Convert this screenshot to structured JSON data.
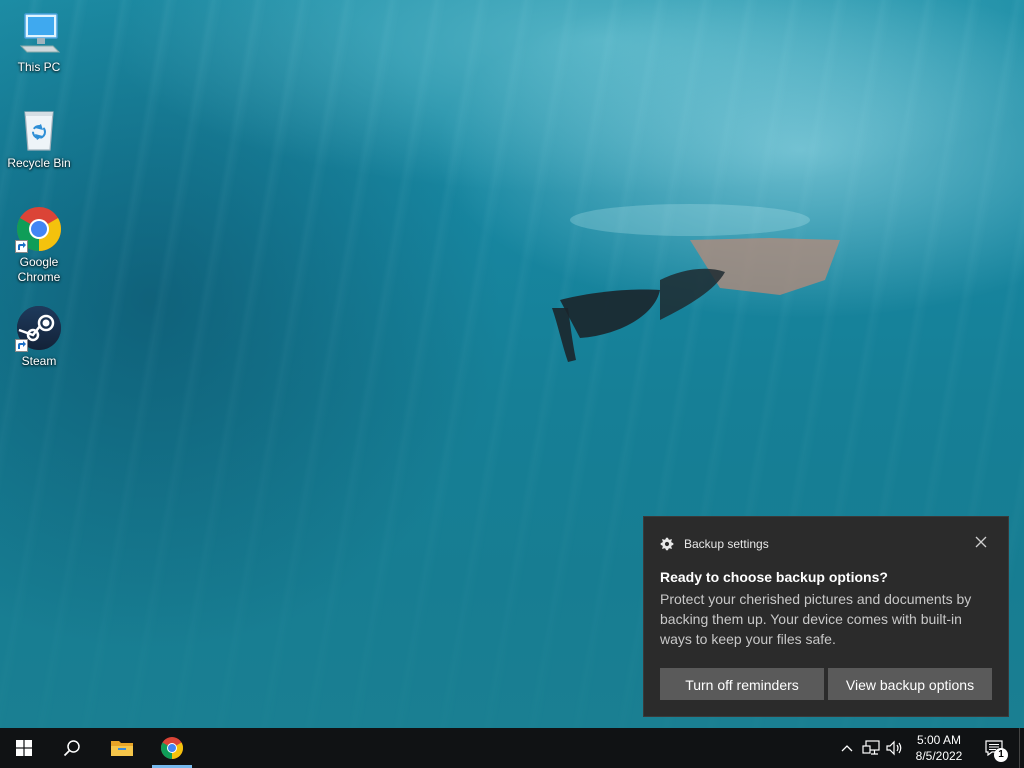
{
  "desktop": {
    "icons": [
      {
        "label": "This PC",
        "icon": "this-pc-icon"
      },
      {
        "label": "Recycle Bin",
        "icon": "recycle-bin-icon"
      },
      {
        "label": "Google Chrome",
        "icon": "chrome-icon"
      },
      {
        "label": "Steam",
        "icon": "steam-icon"
      }
    ]
  },
  "toast": {
    "app_name": "Backup settings",
    "title": "Ready to choose backup options?",
    "body": "Protect your cherished pictures and documents by backing them up. Your device comes with built-in ways to keep your files safe.",
    "buttons": {
      "turn_off": "Turn off reminders",
      "view": "View backup options"
    }
  },
  "taskbar": {
    "clock": {
      "time": "5:00 AM",
      "date": "8/5/2022"
    },
    "notification_count": "1",
    "accent_color": "#76b9ed"
  }
}
